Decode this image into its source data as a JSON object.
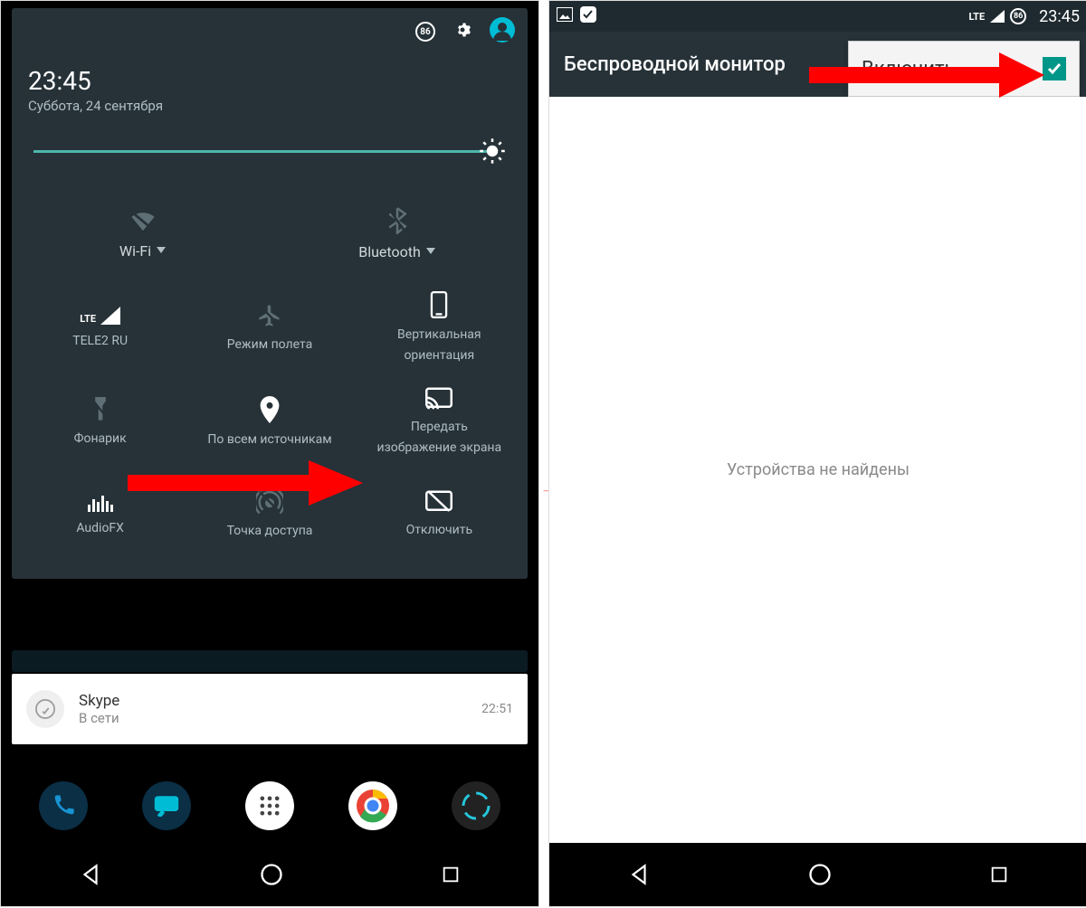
{
  "left": {
    "battery_badge": "86",
    "time": "23:45",
    "date": "Суббота, 24 сентября",
    "tiles": {
      "wifi": "Wi-Fi",
      "bluetooth": "Bluetooth",
      "signal": "TELE2 RU",
      "airplane": "Режим полета",
      "rotate_line1": "Вертикальная",
      "rotate_line2": "ориентация",
      "flashlight": "Фонарик",
      "location": "По всем источникам",
      "cast_line1": "Передать",
      "cast_line2": "изображение экрана",
      "audiofx": "AudioFX",
      "hotspot": "Точка доступа",
      "off": "Отключить",
      "signal_tech": "LTE"
    },
    "notification": {
      "title": "Skype",
      "subtitle": "В сети",
      "time": "22:51"
    }
  },
  "right": {
    "status_time": "23:45",
    "status_battery": "86",
    "status_net": "LTE",
    "appbar_title": "Беспроводной монитор",
    "enable_label": "Включить",
    "body_text": "Устройства не найдены"
  }
}
